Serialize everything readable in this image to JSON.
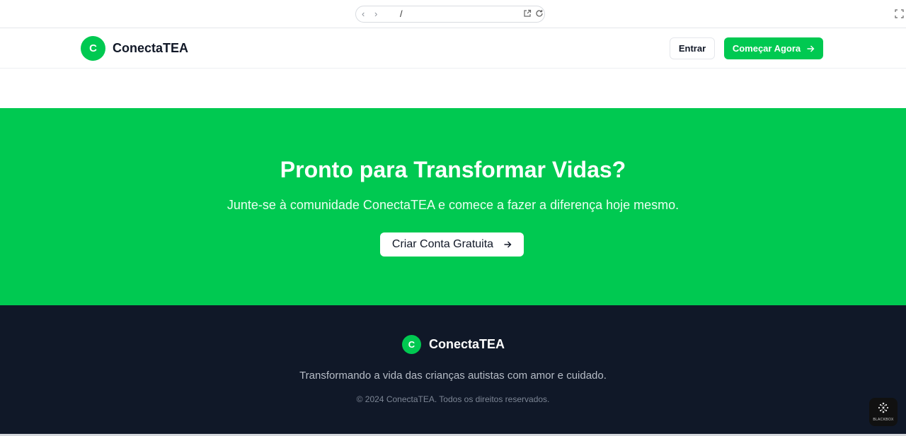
{
  "browser": {
    "url": "/"
  },
  "header": {
    "logo_letter": "C",
    "brand": "ConectaTEA",
    "login_label": "Entrar",
    "start_label": "Começar Agora"
  },
  "cta": {
    "title": "Pronto para Transformar Vidas?",
    "subtitle": "Junte-se à comunidade ConectaTEA e comece a fazer a diferença hoje mesmo.",
    "button_label": "Criar Conta Gratuita"
  },
  "footer": {
    "logo_letter": "C",
    "brand": "ConectaTEA",
    "tagline": "Transformando a vida das crianças autistas com amor e cuidado.",
    "copyright": "© 2024 ConectaTEA. Todos os direitos reservados."
  },
  "widget": {
    "label": "BLACKBOX"
  },
  "colors": {
    "brand_green": "#00c951",
    "footer_bg": "#101828"
  },
  "icons": [
    "back-icon",
    "forward-icon",
    "open-external-icon",
    "reload-icon",
    "fullscreen-icon",
    "arrow-right-icon"
  ]
}
